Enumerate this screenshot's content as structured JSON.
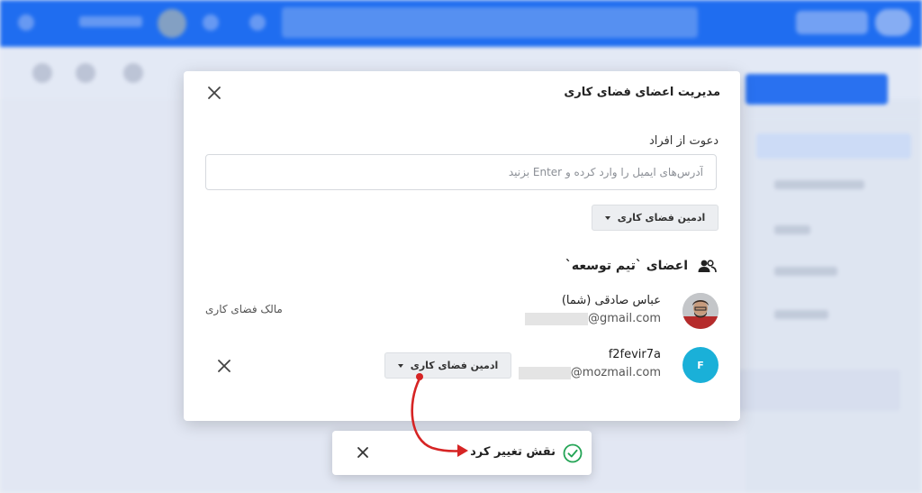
{
  "dialog": {
    "title": "مدیریت اعضای فضای کاری",
    "invite_label": "دعوت از افراد",
    "invite_placeholder": "آدرس‌های ایمیل را وارد کرده و Enter بزنید",
    "invite_role": "ادمین فضای کاری",
    "members_heading": "اعضای `تیم توسعه`",
    "members": [
      {
        "name": "عباس صادقی (شما)",
        "email_suffix": "@gmail.com",
        "role_text": "مالک فضای کاری"
      },
      {
        "name": "f2fevir7a",
        "email_suffix": "@mozmail.com",
        "avatar_letter": "F",
        "role": "ادمین فضای کاری"
      }
    ]
  },
  "toast": {
    "message": "نقش تغییر کرد"
  },
  "colors": {
    "brand": "#1f6ff5",
    "avatar": "#1ab0d8",
    "success": "#23a455",
    "annotation": "#d62424"
  }
}
